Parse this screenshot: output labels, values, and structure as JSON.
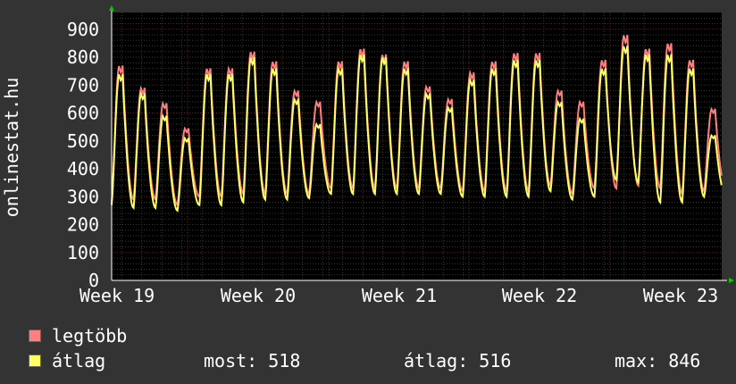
{
  "chart_data": {
    "type": "line",
    "ylabel": "onlinestat.hu",
    "xlabel": "",
    "ylim": [
      0,
      960
    ],
    "yticks": [
      0,
      100,
      200,
      300,
      400,
      500,
      600,
      700,
      800,
      900
    ],
    "xticks": [
      "Week 19",
      "Week 20",
      "Week 21",
      "Week 22",
      "Week 23"
    ],
    "grid": true,
    "series": [
      {
        "name": "legtöbb",
        "color": "#ff7f7f",
        "daily_peaks": [
          770,
          690,
          635,
          545,
          760,
          760,
          820,
          785,
          680,
          640,
          785,
          830,
          810,
          785,
          695,
          650,
          745,
          785,
          815,
          815,
          680,
          640,
          790,
          880,
          830,
          850,
          790,
          615
        ],
        "daily_troughs": [
          280,
          290,
          290,
          270,
          300,
          300,
          310,
          310,
          310,
          310,
          330,
          330,
          330,
          330,
          330,
          330,
          320,
          320,
          320,
          320,
          340,
          310,
          330,
          330,
          340,
          330,
          310,
          320
        ]
      },
      {
        "name": "átlag",
        "color": "#ffff66",
        "daily_peaks": [
          740,
          670,
          590,
          510,
          740,
          740,
          800,
          760,
          650,
          560,
          760,
          810,
          800,
          760,
          670,
          620,
          720,
          760,
          790,
          790,
          640,
          580,
          760,
          840,
          810,
          810,
          760,
          520
        ],
        "daily_troughs": [
          270,
          260,
          260,
          250,
          270,
          270,
          280,
          290,
          290,
          295,
          310,
          310,
          310,
          310,
          310,
          310,
          300,
          300,
          300,
          300,
          320,
          290,
          300,
          360,
          350,
          280,
          280,
          300
        ]
      }
    ]
  },
  "legend": {
    "series1_label": "legtöbb",
    "series2_label": "átlag",
    "most": "most: 518",
    "atlag": "átlag: 516",
    "max": "max: 846"
  },
  "colors": {
    "background": "#333333",
    "plot_bg": "#000000",
    "grid_major": "#6b2020",
    "grid_minor": "#3a3a3a",
    "axis_arrow": "#00cc00"
  }
}
